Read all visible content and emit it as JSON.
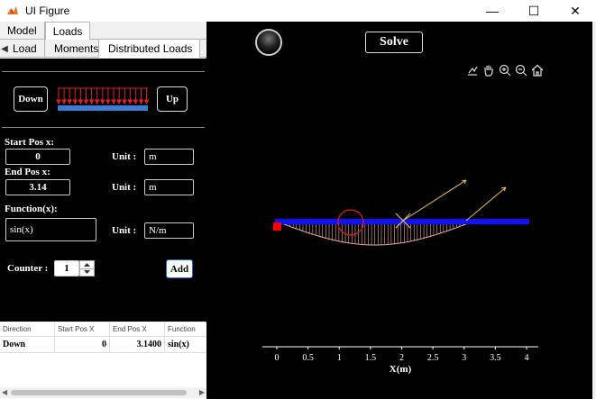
{
  "window": {
    "title": "UI Figure",
    "minimize": "—",
    "maximize": "☐",
    "close": "✕"
  },
  "tabs_outer": [
    "Model",
    "Loads"
  ],
  "tabs_inner": [
    "Load",
    "Moments",
    "Distributed Loads"
  ],
  "load_panel": {
    "down_label": "Down",
    "up_label": "Up",
    "start_label": "Start Pos x:",
    "start_value": "0",
    "start_unit_label": "Unit :",
    "start_unit": "m",
    "end_label": "End Pos x:",
    "end_value": "3.14",
    "end_unit_label": "Unit :",
    "end_unit": "m",
    "function_label": "Function(x):",
    "function_value": "sin(x)",
    "function_unit_label": "Unit :",
    "function_unit": "N/m",
    "counter_label": "Counter :",
    "counter_value": "1",
    "add_label": "Add"
  },
  "table": {
    "headers": [
      "Direction",
      "Start Pos X",
      "End Pos X",
      "Function"
    ],
    "rows": [
      [
        "Down",
        "0",
        "3.1400",
        "sin(x)"
      ]
    ]
  },
  "right_panel": {
    "solve_label": "Solve",
    "tools": [
      "export-icon",
      "pan-icon",
      "zoom-in-icon",
      "zoom-out-icon",
      "home-icon"
    ]
  },
  "plot": {
    "xlabel": "X(m)",
    "xticks": [
      "0",
      "0.5",
      "1",
      "1.5",
      "2",
      "2.5",
      "3",
      "3.5",
      "4"
    ],
    "beam_color": "#1010ff",
    "load_color": "#f0a8a8",
    "arrow_color": "#e8c050",
    "circle_color": "#e02020",
    "support_color": "#ff0000"
  }
}
